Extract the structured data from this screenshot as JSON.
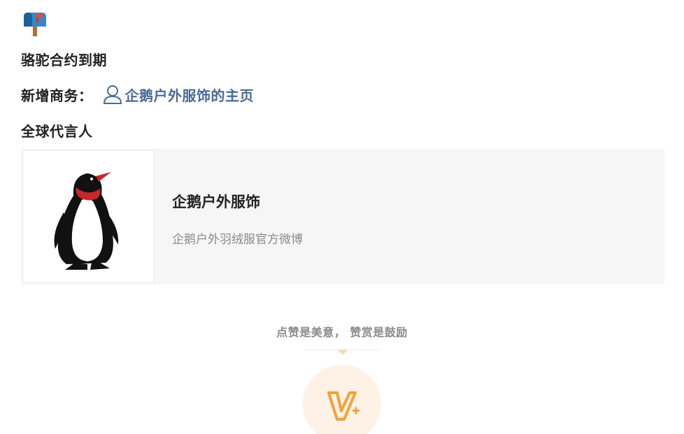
{
  "post": {
    "line1": "骆驼合约到期",
    "line2_prefix": "新增商务：",
    "line2_link": "企鹅户外服饰的主页",
    "line3": "全球代言人"
  },
  "card": {
    "title": "企鹅户外服饰",
    "subtitle": "企鹅户外羽绒服官方微博"
  },
  "reward": {
    "text": "点赞是美意， 赞赏是鼓励"
  },
  "icons": {
    "mailbox": "mailbox-icon",
    "user": "user-outline-icon",
    "penguin": "penguin-logo",
    "reward": "v-plus-reward-icon"
  },
  "colors": {
    "link": "#4a6a95",
    "reward_accent": "#f0a23b",
    "card_bg": "#f6f6f6"
  }
}
